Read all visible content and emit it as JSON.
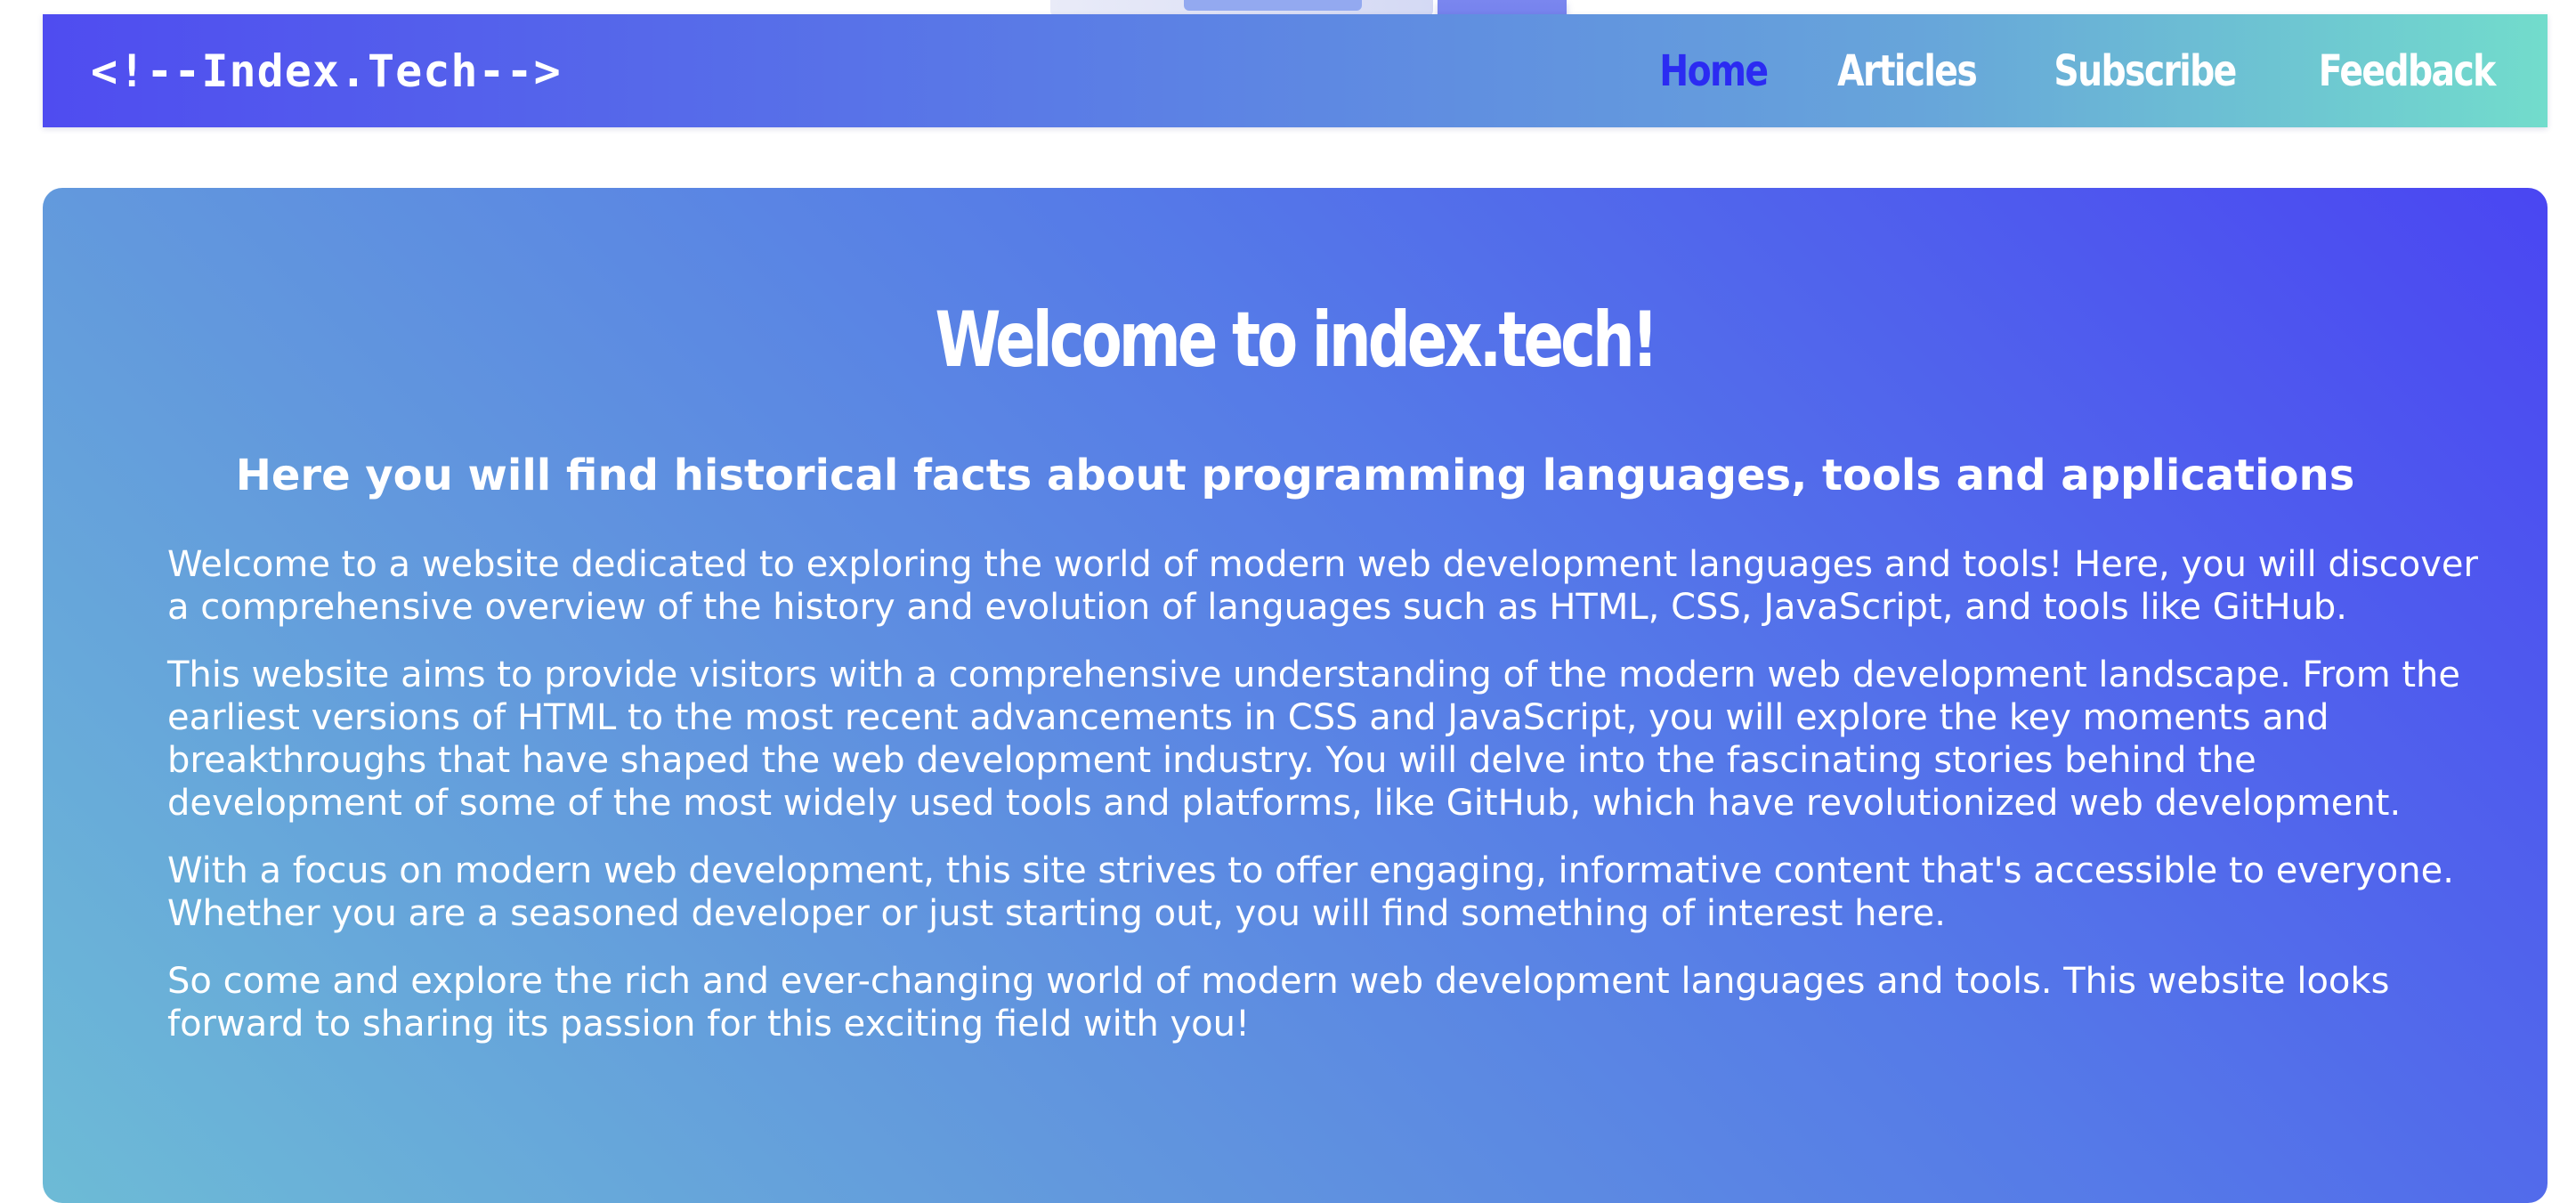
{
  "header": {
    "logo": "<!--Index.Tech-->",
    "nav": [
      {
        "label": "Home",
        "active": true
      },
      {
        "label": "Articles",
        "active": false
      },
      {
        "label": "Subscribe",
        "active": false
      },
      {
        "label": "Feedback",
        "active": false
      }
    ]
  },
  "hero": {
    "title": "Welcome to index.tech!",
    "subtitle": "Here you will find historical facts about programming languages, tools and applications",
    "paragraphs": [
      "Welcome to a website dedicated to exploring the world of modern web development languages and tools! Here, you will discover a comprehensive overview of the history and evolution of languages such as HTML, CSS, JavaScript, and tools like GitHub.",
      "This website aims to provide visitors with a comprehensive understanding of the modern web development landscape. From the earliest versions of HTML to the most recent advancements in CSS and JavaScript, you will explore the key moments and breakthroughs that have shaped the web development industry. You will delve into the fascinating stories behind the development of some of the most widely used tools and platforms, like GitHub, which have revolutionized web development.",
      "With a focus on modern web development, this site strives to offer engaging, informative content that's accessible to everyone. Whether you are a seasoned developer or just starting out, you will find something of interest here.",
      "So come and explore the rich and ever-changing world of modern web development languages and tools. This website looks forward to sharing its passion for this exciting field with you!"
    ]
  },
  "colors": {
    "nav_gradient_start": "#4f4cf0",
    "nav_gradient_end": "#72dccc",
    "active_link": "#2b2bf2",
    "hero_gradient_start": "#4a46f2",
    "hero_gradient_end": "#6dbbd6",
    "text": "#ffffff"
  }
}
